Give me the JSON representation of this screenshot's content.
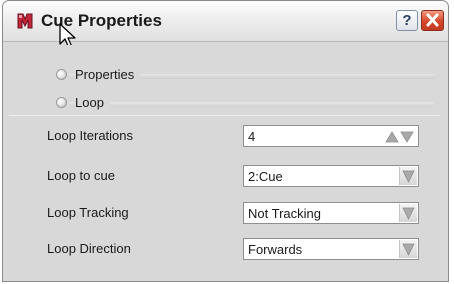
{
  "window": {
    "title": "Cue Properties",
    "help_label": "?"
  },
  "sections": {
    "properties_label": "Properties",
    "loop_label": "Loop"
  },
  "loop_properties": {
    "iterations": {
      "label": "Loop Iterations",
      "value": "4"
    },
    "to_cue": {
      "label": "Loop to cue",
      "value": "2:Cue"
    },
    "tracking": {
      "label": "Loop Tracking",
      "value": "Not Tracking"
    },
    "direction": {
      "label": "Loop Direction",
      "value": "Forwards"
    }
  },
  "icons": {
    "app": "cue-app-icon",
    "cursor": "mouse-pointer-icon",
    "help": "help-icon",
    "close": "close-icon",
    "stepper": "up-down-arrows-icon",
    "dropdown": "chevron-down-icon",
    "section_toggle": "radio-bullet-icon"
  },
  "colors": {
    "close_button": "#d5472c",
    "panel_background": "#d9d9d9",
    "field_background": "#ffffff"
  }
}
